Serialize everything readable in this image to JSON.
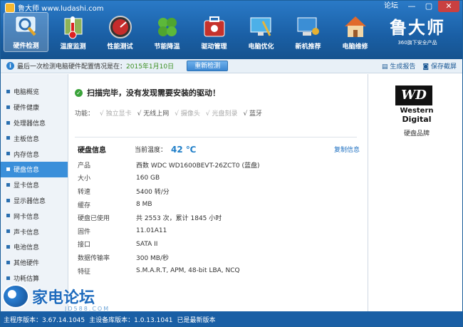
{
  "window": {
    "title": "鲁大师 www.ludashi.com",
    "forum": "论坛",
    "minimize": "—",
    "maximize": "▢",
    "close": "✕"
  },
  "nav": [
    {
      "label": "硬件检测",
      "icon": "magnifier-icon"
    },
    {
      "label": "温度监测",
      "icon": "thermometer-icon"
    },
    {
      "label": "性能测试",
      "icon": "gauge-icon"
    },
    {
      "label": "节能降温",
      "icon": "leaf-icon"
    },
    {
      "label": "驱动管理",
      "icon": "toolbox-icon"
    },
    {
      "label": "电脑优化",
      "icon": "monitor-broom-icon"
    },
    {
      "label": "新机推荐",
      "icon": "computer-ribbon-icon"
    },
    {
      "label": "电脑维修",
      "icon": "house-icon"
    }
  ],
  "brand": {
    "name": "鲁大师",
    "tagline": "360旗下安全产品"
  },
  "infobar": {
    "text": "最后一次检测电脑硬件配置情况是在：",
    "date": "2015年1月10日",
    "recheck": "重新检测",
    "report": "生成报告",
    "screenshot": "保存截屏"
  },
  "sidebar": [
    "电脑概览",
    "硬件健康",
    "处理器信息",
    "主板信息",
    "内存信息",
    "硬盘信息",
    "显卡信息",
    "显示器信息",
    "网卡信息",
    "声卡信息",
    "电池信息",
    "其他硬件",
    "功耗估算"
  ],
  "scan": {
    "message": "扫描完毕，没有发现需要安装的驱动！"
  },
  "features": {
    "label": "功能：",
    "items": [
      {
        "text": "√ 独立显卡",
        "enabled": false
      },
      {
        "text": "√ 无线上网",
        "enabled": true
      },
      {
        "text": "√ 摄像头",
        "enabled": false
      },
      {
        "text": "√ 光盘刻录",
        "enabled": false
      },
      {
        "text": "√ 蓝牙",
        "enabled": true
      }
    ]
  },
  "disk": {
    "heading": "硬盘信息",
    "temp_label": "当前温度：",
    "temp_value": "42 ℃",
    "copy": "复制信息",
    "rows": [
      {
        "k": "产品",
        "v": "西数 WDC WD1600BEVT-26ZCT0 (蓝盘)"
      },
      {
        "k": "大小",
        "v": "160 GB"
      },
      {
        "k": "转速",
        "v": "5400 转/分"
      },
      {
        "k": "缓存",
        "v": "8 MB"
      },
      {
        "k": "硬盘已使用",
        "v": "共 2553 次，累计 1845 小时"
      },
      {
        "k": "固件",
        "v": "11.01A11"
      },
      {
        "k": "接口",
        "v": "SATA II"
      },
      {
        "k": "数据传输率",
        "v": "300 MB/秒"
      },
      {
        "k": "特征",
        "v": "S.M.A.R.T,  APM,  48-bit LBA,  NCQ"
      }
    ]
  },
  "brandpane": {
    "logo": "WD",
    "line1": "Western",
    "line2": "Digital",
    "label": "硬盘品牌"
  },
  "status": {
    "program": "主程序版本：3.67.14.1045",
    "hwdb": "主设备库版本：1.0.13.1041",
    "latest": "已是最新版本"
  },
  "watermark": {
    "name": "家电论坛",
    "url": "JD588.COM"
  },
  "colors": {
    "titlebar": "#1a5fa5",
    "accent": "#3a8fda",
    "date": "#3a8f1f",
    "temp": "#1f7ec8"
  }
}
